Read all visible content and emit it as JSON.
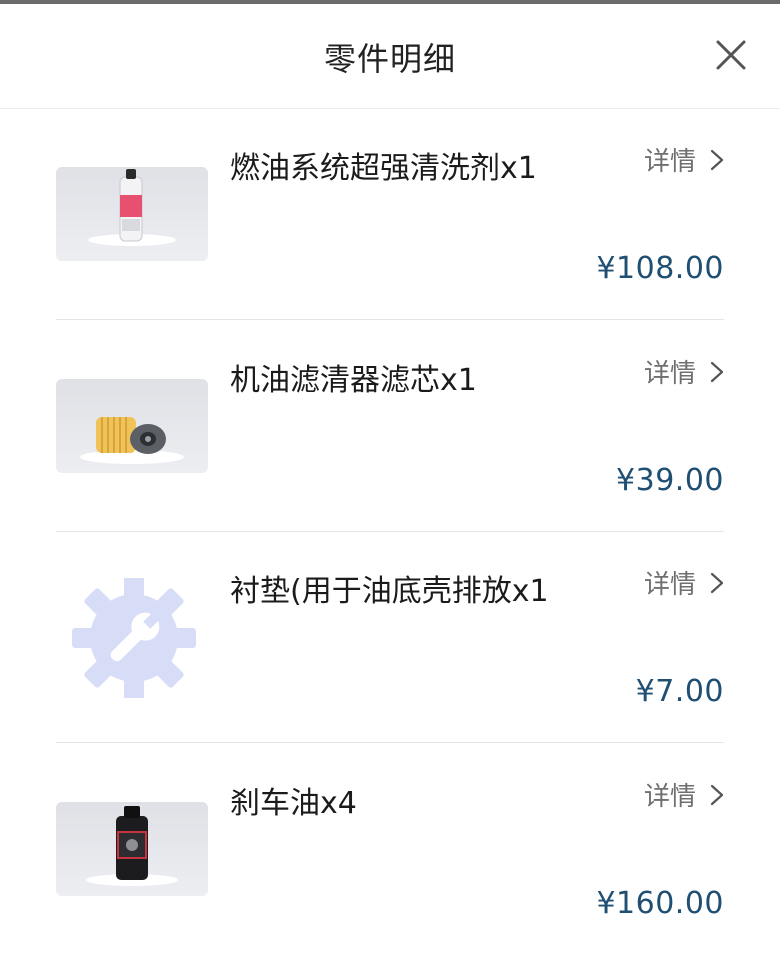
{
  "header": {
    "title": "零件明细"
  },
  "colors": {
    "price": "#1f4f73",
    "divider": "#e6e6e6",
    "placeholder_icon": "#d8ddf7"
  },
  "items": [
    {
      "name": "燃油系统超强清洗剂x1",
      "detail_label": "详情",
      "price": "¥108.00",
      "image": "fuel-cleaner-bottle"
    },
    {
      "name": "机油滤清器滤芯x1",
      "detail_label": "详情",
      "price": "¥39.00",
      "image": "oil-filter"
    },
    {
      "name": "衬垫(用于油底壳排放x1",
      "detail_label": "详情",
      "price": "¥7.00",
      "image": "gear-wrench-placeholder-icon"
    },
    {
      "name": "刹车油x4",
      "detail_label": "详情",
      "price": "¥160.00",
      "image": "brake-fluid-bottle"
    }
  ]
}
